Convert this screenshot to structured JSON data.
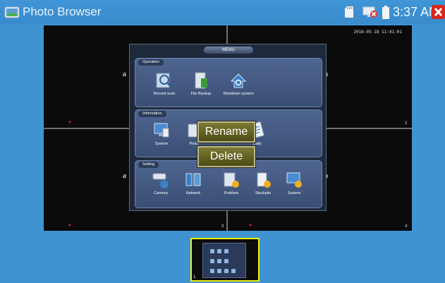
{
  "titlebar": {
    "title": "Photo Browser",
    "clock": "3:37 AM"
  },
  "viewer": {
    "timestamp": "2016-05-18 11:41:01",
    "channels": [
      "?",
      "?",
      "2",
      "3",
      "4"
    ],
    "side_letters": [
      "a",
      "a",
      "a",
      "a"
    ]
  },
  "menu": {
    "header": "MENU",
    "groups": {
      "operation": {
        "label": "Operation",
        "items": [
          "Record scan",
          "File Backup",
          "Shutdown system"
        ]
      },
      "information": {
        "label": "Information",
        "items": [
          "System",
          "Probl",
          "Daily"
        ]
      },
      "setting": {
        "label": "Setting",
        "items": [
          "Camera",
          "Network",
          "Problem",
          "Stockpile",
          "System"
        ]
      }
    }
  },
  "context_menu": {
    "rename": "Rename",
    "delete": "Delete"
  },
  "thumbnails": {
    "items": [
      {
        "number": "1"
      }
    ]
  },
  "colors": {
    "background": "#3f93d3",
    "selection": "#f0f000",
    "close": "#d8261c",
    "context_button": "#6a6a28"
  }
}
